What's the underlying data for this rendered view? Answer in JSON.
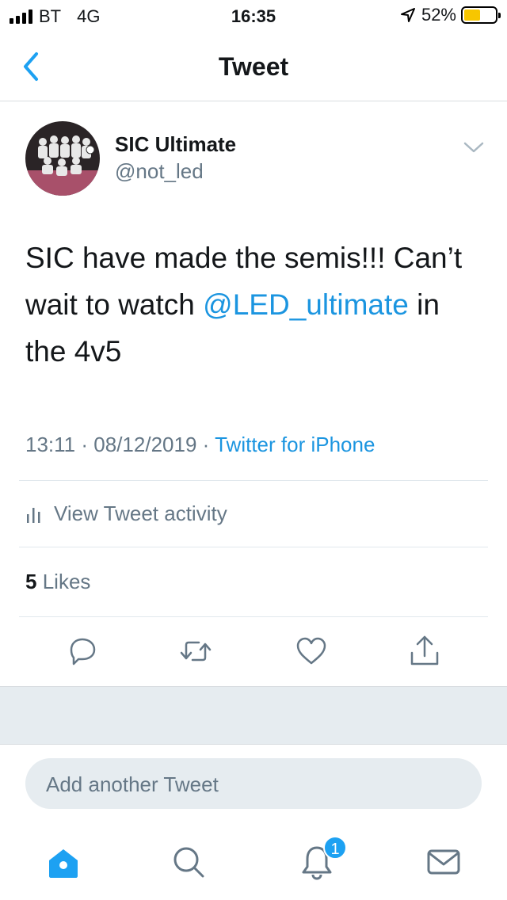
{
  "status_bar": {
    "carrier": "BT",
    "network": "4G",
    "time": "16:35",
    "battery": "52%"
  },
  "nav": {
    "title": "Tweet",
    "back_icon": "chevron-left-icon"
  },
  "tweet": {
    "author_name": "SIC Ultimate",
    "author_handle": "@not_led",
    "text_before": "SIC have made the semis!!! Can’t wait to watch ",
    "mention": "@LED_ultimate",
    "text_after": " in the 4v5",
    "time": "13:11",
    "date": "08/12/2019",
    "source": "Twitter for iPhone",
    "separator": "·",
    "activity_label": "View Tweet activity",
    "likes_count": "5",
    "likes_label": "Likes"
  },
  "actions": [
    "reply-icon",
    "retweet-icon",
    "like-icon",
    "share-icon"
  ],
  "compose": {
    "placeholder": "Add another Tweet"
  },
  "tab_bar": {
    "tabs": [
      "home-icon",
      "search-icon",
      "notifications-icon",
      "messages-icon"
    ],
    "notification_badge": "1"
  },
  "colors": {
    "accent": "#1da1f2",
    "link": "#1b95e0",
    "secondary_text": "#657786",
    "battery": "#f7c600"
  }
}
